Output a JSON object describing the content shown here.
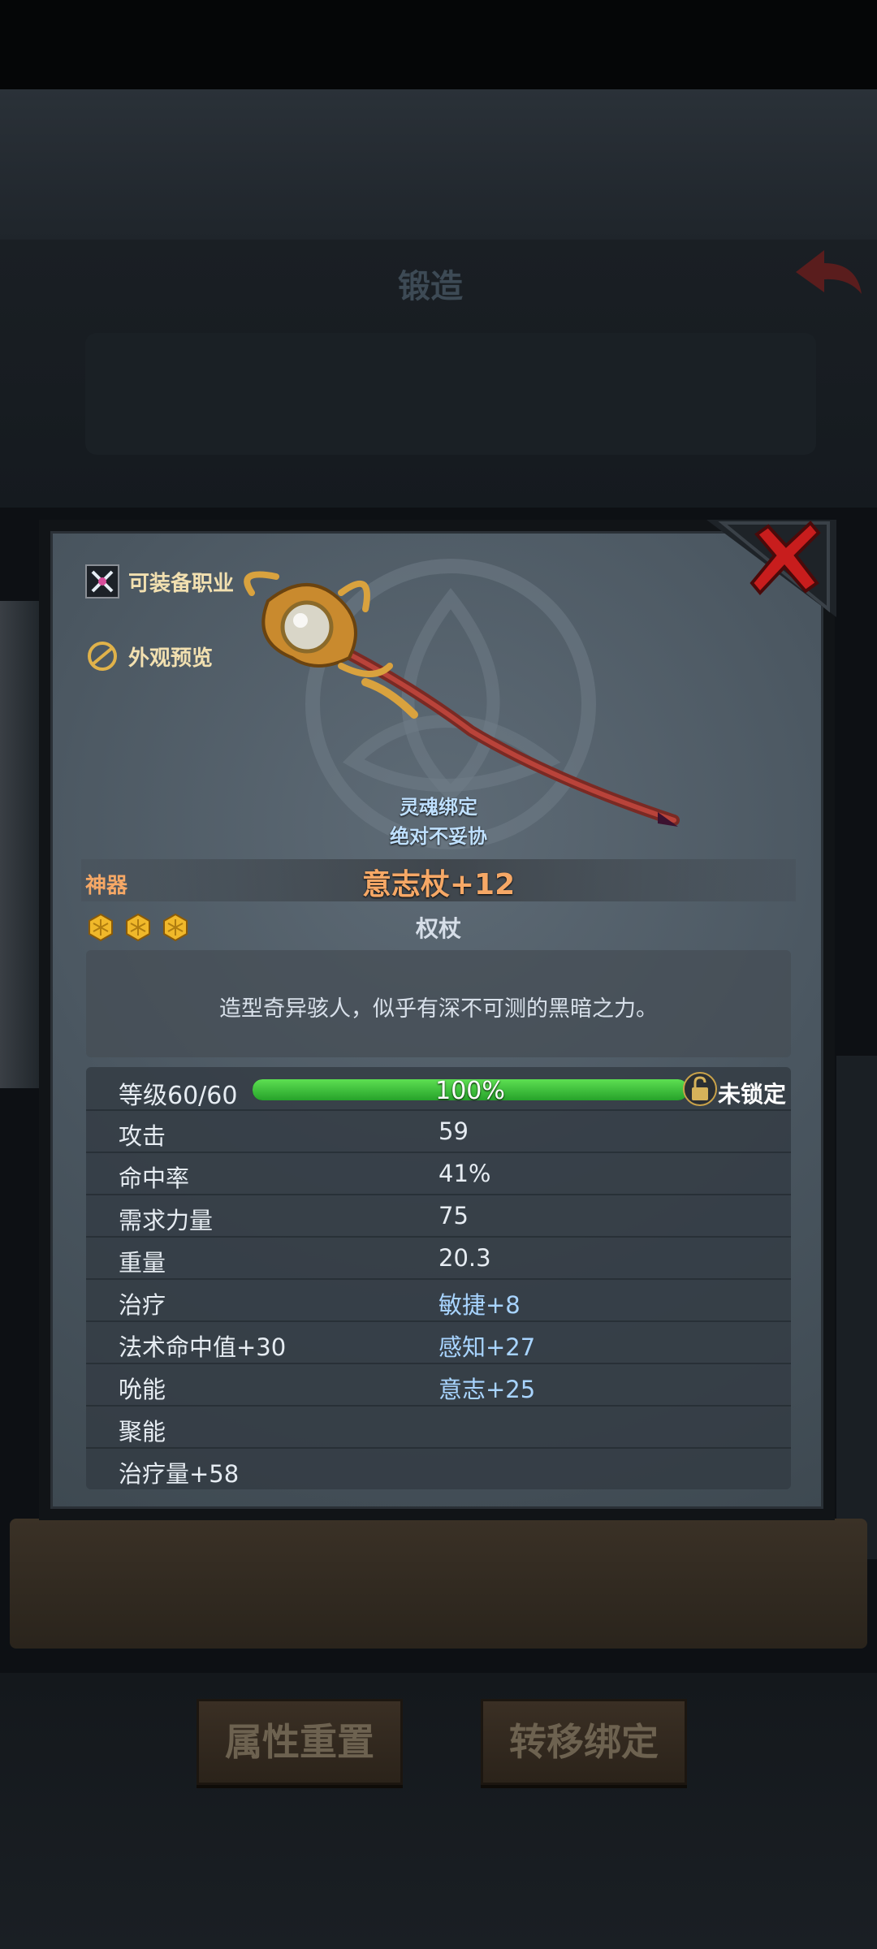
{
  "background": {
    "title": "锻造",
    "buttons": {
      "reset": "属性重置",
      "transfer": "转移绑定"
    }
  },
  "item": {
    "equip_class_link": "可装备职业",
    "preview_link": "外观预览",
    "bind_line1": "灵魂绑定",
    "bind_line2": "绝对不妥协",
    "quality": "神器",
    "name": "意志杖+12",
    "stars": 3,
    "type": "权杖",
    "description": "造型奇异骇人，似乎有深不可测的黑暗之力。",
    "level": {
      "label": "等级60/60",
      "progress_text": "100%",
      "progress": 1.0,
      "lock_text": "未锁定"
    },
    "stats": [
      {
        "c1": "攻击",
        "c2": "59"
      },
      {
        "c1": "命中率",
        "c2": "41%"
      },
      {
        "c1": "需求力量",
        "c2": "75"
      },
      {
        "c1": "重量",
        "c2": "20.3"
      },
      {
        "c1": "治疗",
        "c2": "敏捷+8"
      },
      {
        "c1": "法术命中值+30",
        "c2": "感知+27"
      },
      {
        "c1": "吮能",
        "c2": "意志+25"
      },
      {
        "c1": "聚能",
        "c2": ""
      },
      {
        "c1": "治疗量+58",
        "c2": ""
      }
    ]
  },
  "colors": {
    "accent_orange": "#f6a866",
    "bonus_blue": "#a8d4ff",
    "progress_green": "#3fc43c"
  }
}
